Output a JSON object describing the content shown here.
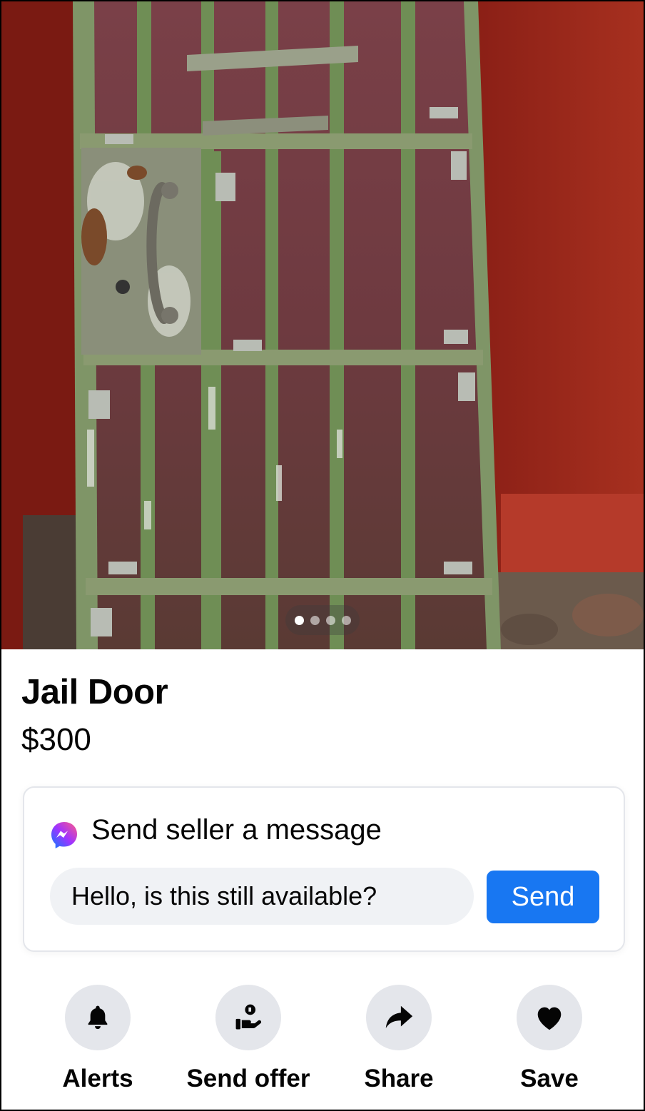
{
  "photo": {
    "icon": "jail-door-photo",
    "carousel": {
      "count": 4,
      "active_index": 0
    }
  },
  "listing": {
    "title": "Jail Door",
    "price": "$300"
  },
  "message_card": {
    "icon": "messenger-icon",
    "title": "Send seller a message",
    "input_value": "Hello, is this still available?",
    "send_label": "Send",
    "send_color": "#1877f2"
  },
  "actions": [
    {
      "label": "Alerts",
      "icon": "bell-icon"
    },
    {
      "label": "Send offer",
      "icon": "offer-icon"
    },
    {
      "label": "Share",
      "icon": "share-icon"
    },
    {
      "label": "Save",
      "icon": "heart-icon"
    }
  ]
}
